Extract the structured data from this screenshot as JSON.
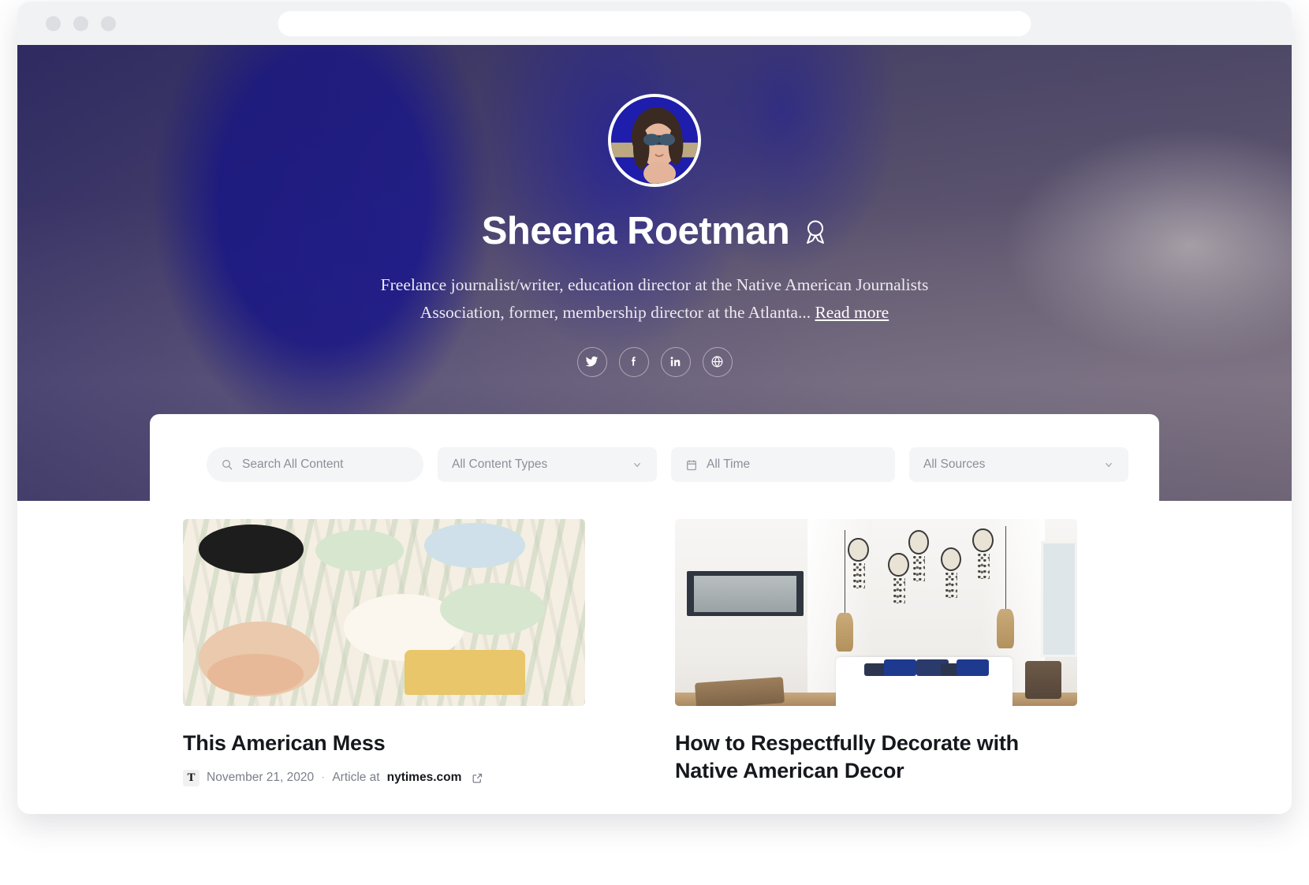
{
  "browser": {
    "traffic_lights": [
      "close",
      "minimize",
      "maximize"
    ],
    "url_value": "",
    "url_placeholder": ""
  },
  "profile": {
    "name": "Sheena Roetman",
    "badge_icon": "award-ribbon-icon",
    "avatar_icon": "avatar",
    "bio_line1": "Freelance journalist/writer, education director at the Native American Journalists",
    "bio_line2": "Association, former, membership director at the Atlanta...",
    "read_more_label": "Read more",
    "social": [
      {
        "name": "twitter",
        "icon": "twitter-icon"
      },
      {
        "name": "facebook",
        "icon": "facebook-icon"
      },
      {
        "name": "linkedin",
        "icon": "linkedin-icon"
      },
      {
        "name": "website",
        "icon": "globe-icon"
      }
    ]
  },
  "filters": {
    "search_placeholder": "Search All Content",
    "search_value": "",
    "search_icon": "search-icon",
    "content_types_label": "All Content Types",
    "content_types_icon": "chevron-down-icon",
    "time_label": "All Time",
    "time_icon": "calendar-icon",
    "sources_label": "All Sources",
    "sources_icon": "chevron-down-icon"
  },
  "results": {
    "cards": [
      {
        "title": "This American Mess",
        "date": "November 21, 2020",
        "separator": "·",
        "source_prefix": "Article at",
        "source_domain": "nytimes.com",
        "favicon_glyph": "T",
        "favicon_name": "nytimes-favicon",
        "external_link_icon": "external-link-icon",
        "thumb_name": "article-thumbnail-illustration"
      },
      {
        "title": "How to Respectfully Decorate with Native American Decor",
        "date": "",
        "separator": "",
        "source_prefix": "",
        "source_domain": "",
        "favicon_glyph": "",
        "favicon_name": "",
        "external_link_icon": "",
        "thumb_name": "article-thumbnail-bedroom"
      }
    ]
  },
  "colors": {
    "hero_overlay": "#3a3466",
    "panel_bg": "#ffffff",
    "field_bg": "#f4f5f7",
    "muted_text": "#7b7f89",
    "title_text": "#16181d",
    "chrome_bg": "#f1f2f4"
  }
}
